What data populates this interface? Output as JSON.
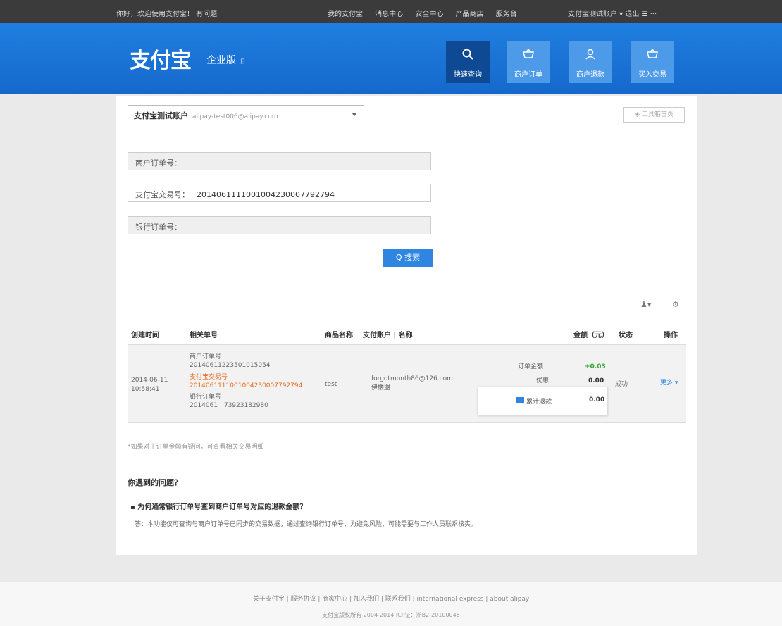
{
  "topbar": {
    "greeting": "你好，欢迎使用支付宝！ 有问题",
    "nav": [
      "我的支付宝",
      "消息中心",
      "安全中心",
      "产品商店",
      "服务台"
    ],
    "right": "支付宝测试账户 ▾ 退出  ☰  ···"
  },
  "header": {
    "logo": "支付宝",
    "edition": "企业版",
    "edition_sub": "旧",
    "tiles": [
      {
        "label": "快速查询",
        "icon": "search-icon",
        "active": true
      },
      {
        "label": "商户订单",
        "icon": "basket-icon",
        "active": false
      },
      {
        "label": "商户退款",
        "icon": "person-icon",
        "active": false
      },
      {
        "label": "买入交易",
        "icon": "basket-icon",
        "active": false
      }
    ]
  },
  "account": {
    "name": "支付宝测试账户",
    "email": "alipay-test006@alipay.com",
    "tool_btn": "◈ 工具箱首页"
  },
  "form": {
    "merchant_label": "商户订单号：",
    "alipay_label": "支付宝交易号：",
    "alipay_value": "2014061111001004230007792794",
    "bank_label": "银行订单号：",
    "search_btn": "Q 搜索"
  },
  "table": {
    "tools": [
      "♟▾",
      "⚙"
    ],
    "headers": [
      "创建时间",
      "相关单号",
      "商品名称",
      "支付账户 | 名称",
      "金额（元）",
      "状态",
      "操作"
    ],
    "row": {
      "date": "2014-06-11",
      "time": "10:58:41",
      "merchant_label": "商户订单号",
      "merchant_no": "20140611223501015054",
      "alipay_label": "支付宝交易号",
      "alipay_no": "2014061111001004230007792794",
      "bank_label": "银行订单号",
      "bank_no": "2014061 : 73923182980",
      "product": "test",
      "account_email": "forgotmonth86@126.com",
      "account_name": "伊楼盟",
      "amount_labels": [
        "订单金额",
        "优惠"
      ],
      "amounts": [
        "+0.03",
        "0.00"
      ],
      "status": "成功",
      "action": "更多 ▾"
    },
    "popup": {
      "label": "累计退款",
      "value": "0.00"
    }
  },
  "note": "*如果对于订单金额有疑问，可查看相关交易明细",
  "faq": {
    "title": "你遇到的问题？",
    "question": "▪ 为何通常银行订单号查到商户订单号对应的退款金额？",
    "answer": "答：本功能仅可查询与商户订单号已同步的交易数据，通过查询银行订单号，为避免风险，可能需要与工作人员联系核实。"
  },
  "footer": {
    "links": "关于支付宝 | 服务协议 | 商家中心 | 加入我们 | 联系我们 | international express | about alipay",
    "copyright": "支付宝版权所有 2004-2014  ICP证：浙B2-20100045"
  }
}
